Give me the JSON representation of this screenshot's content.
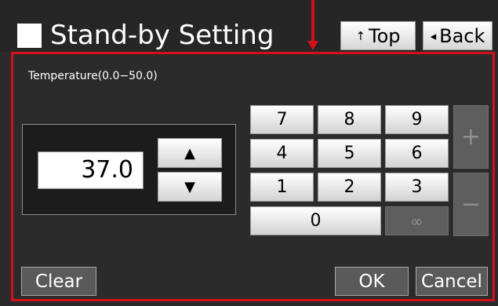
{
  "header": {
    "title": "Stand-by Setting",
    "top_label": "Top",
    "top_icon": "arrow-up-glyph",
    "back_label": "Back",
    "back_icon": "triangle-left-glyph"
  },
  "panel": {
    "label": "Temperature(0.0−50.0)",
    "value": "37.0",
    "step_up": "▲",
    "step_down": "▼"
  },
  "keypad": {
    "keys": [
      "7",
      "8",
      "9",
      "4",
      "5",
      "6",
      "1",
      "2",
      "3",
      "0",
      "∞"
    ],
    "plus": "+",
    "minus": "−"
  },
  "footer": {
    "clear": "Clear",
    "ok": "OK",
    "cancel": "Cancel"
  },
  "colors": {
    "background": "#2b2b2b",
    "highlight_red": "#d4101a",
    "button_gray": "#5a5a5a"
  }
}
